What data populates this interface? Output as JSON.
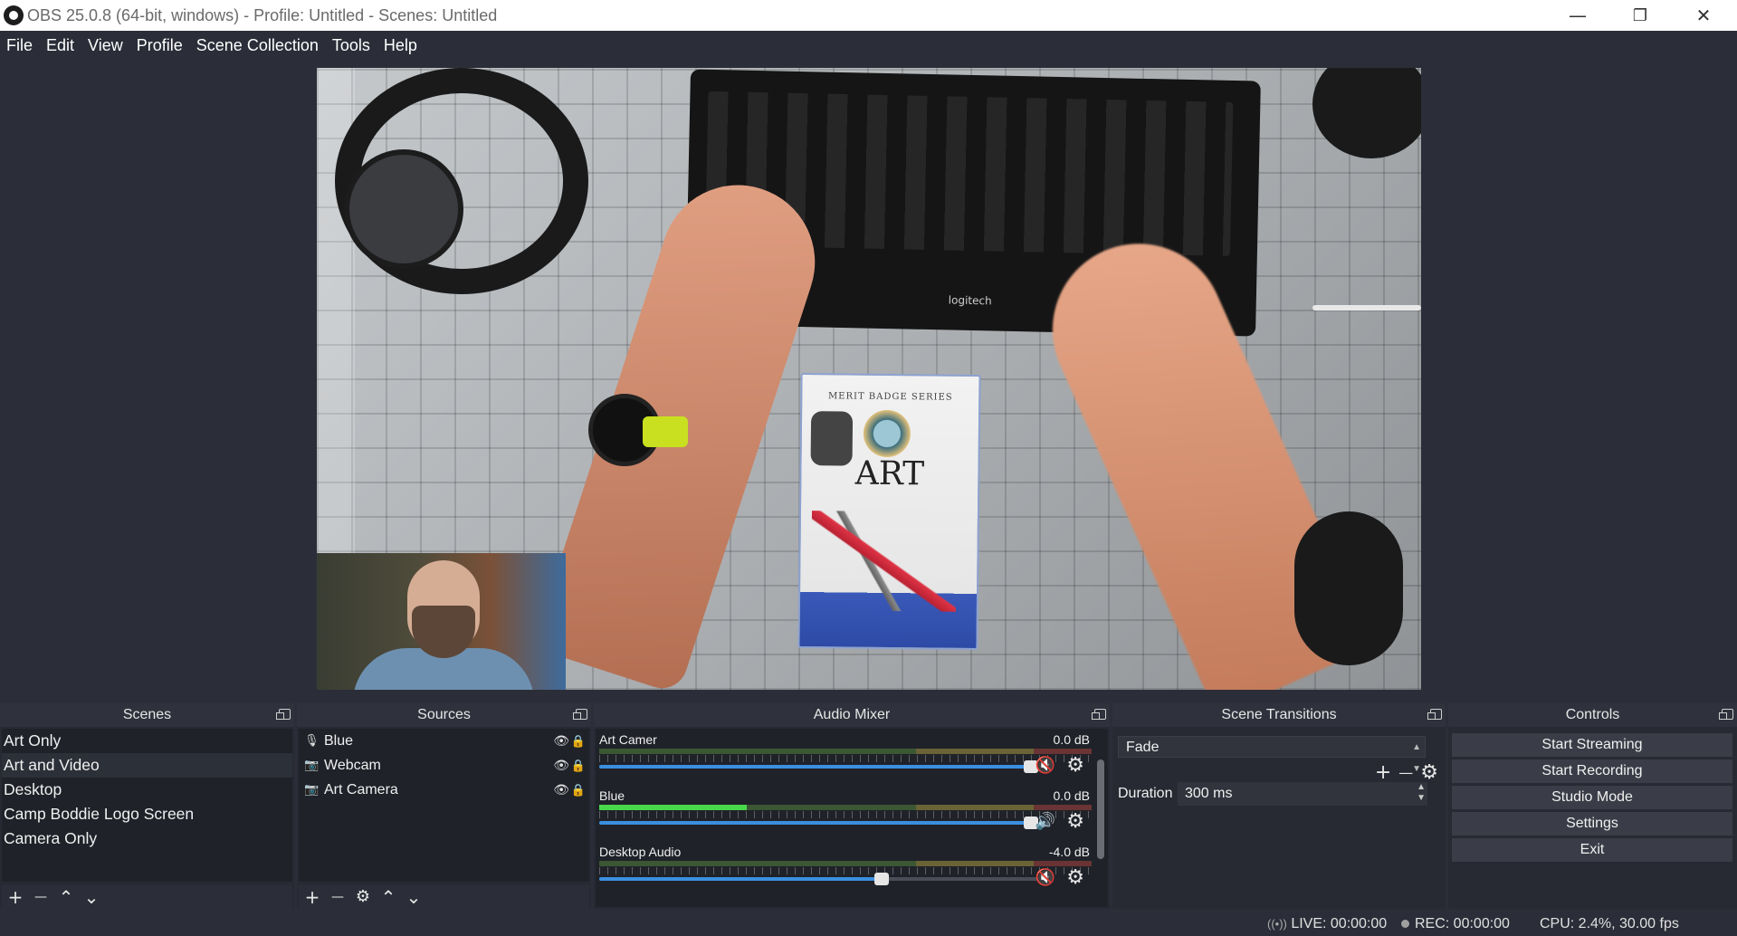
{
  "window": {
    "title": "OBS 25.0.8 (64-bit, windows) - Profile: Untitled - Scenes: Untitled",
    "controls": {
      "minimize": "—",
      "restore": "❐",
      "close": "✕"
    }
  },
  "menu": [
    "File",
    "Edit",
    "View",
    "Profile",
    "Scene Collection",
    "Tools",
    "Help"
  ],
  "preview": {
    "book_series": "MERIT BADGE SERIES",
    "book_title": "ART",
    "keyboard_brand": "logitech"
  },
  "docks": {
    "scenes": {
      "title": "Scenes",
      "items": [
        "Art Only",
        "Art and Video",
        "Desktop",
        "Camp Boddie Logo Screen",
        "Camera Only"
      ],
      "selected_index": 1,
      "toolbar": [
        "+",
        "—",
        "⌃",
        "⌄"
      ]
    },
    "sources": {
      "title": "Sources",
      "items": [
        {
          "name": "Blue",
          "icon": "microphone-icon",
          "glyph": "🎙"
        },
        {
          "name": "Webcam",
          "icon": "camera-icon",
          "glyph": "📷"
        },
        {
          "name": "Art Camera",
          "icon": "camera-icon",
          "glyph": "📷"
        }
      ],
      "toolbar": [
        "+",
        "—",
        "⚙",
        "⌃",
        "⌄"
      ]
    },
    "audio_mixer": {
      "title": "Audio Mixer",
      "channels": [
        {
          "name": "Art Camer",
          "db": "0.0 dB",
          "muted": true,
          "volume": 1.0,
          "level": 0.0
        },
        {
          "name": "Blue",
          "db": "0.0 dB",
          "muted": false,
          "volume": 1.0,
          "level": 0.3
        },
        {
          "name": "Desktop Audio",
          "db": "-4.0 dB",
          "muted": true,
          "volume": 0.66,
          "level": 0.0
        }
      ]
    },
    "transitions": {
      "title": "Scene Transitions",
      "selected": "Fade",
      "duration_label": "Duration",
      "duration_value": "300 ms"
    },
    "controls": {
      "title": "Controls",
      "buttons": [
        "Start Streaming",
        "Start Recording",
        "Studio Mode",
        "Settings",
        "Exit"
      ]
    }
  },
  "status": {
    "live": "LIVE: 00:00:00",
    "rec": "REC: 00:00:00",
    "cpu": "CPU: 2.4%, 30.00 fps"
  },
  "colors": {
    "background": "#2b2e38",
    "panel": "#1f2229",
    "meter_green": "#49d84a",
    "slider_blue": "#3b8fe0",
    "mute_red": "#e0312b"
  }
}
